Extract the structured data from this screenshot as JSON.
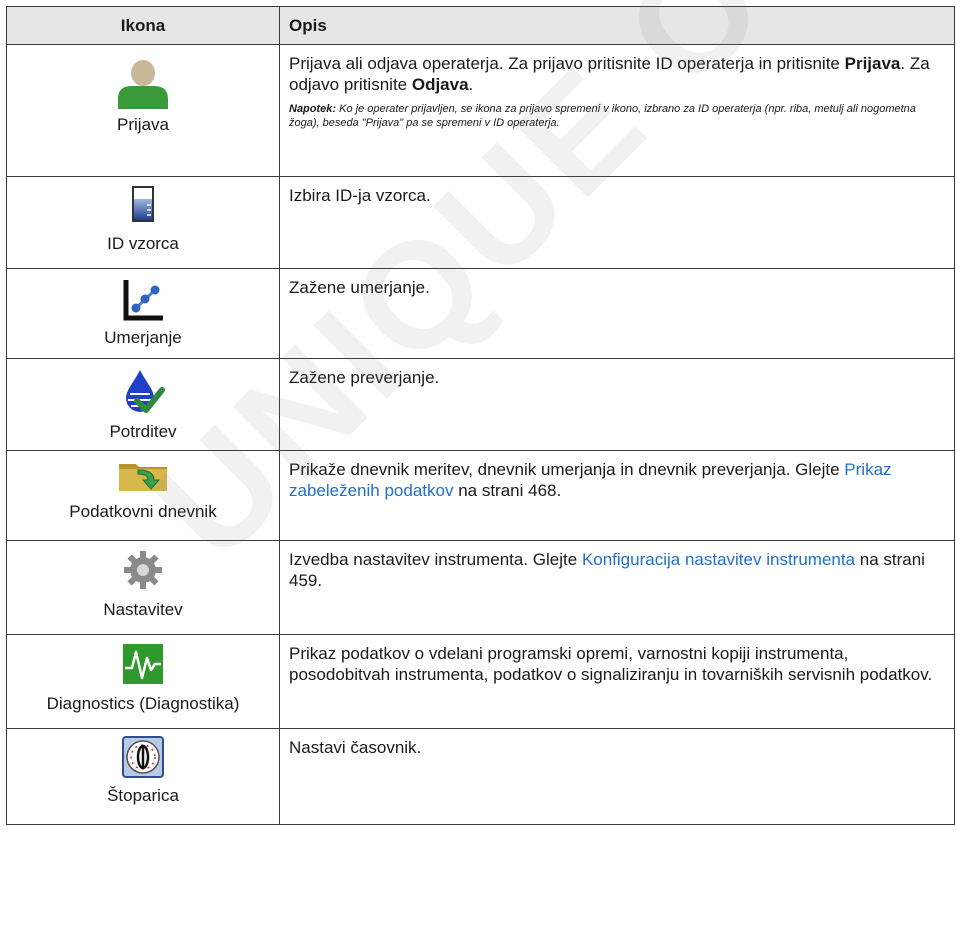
{
  "header": {
    "col_icon": "Ikona",
    "col_desc": "Opis"
  },
  "rows": [
    {
      "label": "Prijava",
      "icon": "person-icon",
      "desc_pre": "Prijava ali odjava operaterja. Za prijavo pritisnite ID operaterja in pritisnite ",
      "desc_bold1": "Prijava",
      "desc_mid": ". Za odjavo pritisnite ",
      "desc_bold2": "Odjava",
      "desc_end": ".",
      "note_label": "Napotek:",
      "note_text": " Ko je operater prijavljen, se ikona za prijavo spremeni v ikono, izbrano za ID operaterja (npr. riba, metulj ali nogometna žoga), beseda \"Prijava\" pa se spremeni v ID operaterja."
    },
    {
      "label": "ID vzorca",
      "icon": "beaker-icon",
      "desc": "Izbira ID-ja vzorca."
    },
    {
      "label": "Umerjanje",
      "icon": "calibration-icon",
      "desc": "Zažene umerjanje."
    },
    {
      "label": "Potrditev",
      "icon": "verification-icon",
      "desc": "Zažene preverjanje."
    },
    {
      "label": "Podatkovni dnevnik",
      "icon": "data-log-folder-icon",
      "desc_pre": "Prikaže dnevnik meritev, dnevnik umerjanja in dnevnik preverjanja. Glejte ",
      "link": "Prikaz zabeleženih podatkov",
      "desc_post": " na strani 468."
    },
    {
      "label": "Nastavitev",
      "icon": "gear-icon",
      "desc_pre": "Izvedba nastavitev instrumenta. Glejte ",
      "link": "Konfiguracija nastavitev instrumenta",
      "desc_post": " na strani 459."
    },
    {
      "label": "Diagnostics (Diagnostika)",
      "icon": "diagnostics-waveform-icon",
      "desc": "Prikaz podatkov o vdelani programski opremi, varnostni kopiji instrumenta, posodobitvah instrumenta, podatkov o signaliziranju in tovarniških servisnih podatkov."
    },
    {
      "label": "Štoparica",
      "icon": "timer-icon",
      "desc": "Nastavi časovnik."
    }
  ],
  "watermark": "UNIQUE OUTSCHER SAS",
  "colors": {
    "link": "#1f6fcc",
    "header_bg": "#e6e6e6",
    "person": "#3a9a3a",
    "diag": "#2e9a2e"
  }
}
